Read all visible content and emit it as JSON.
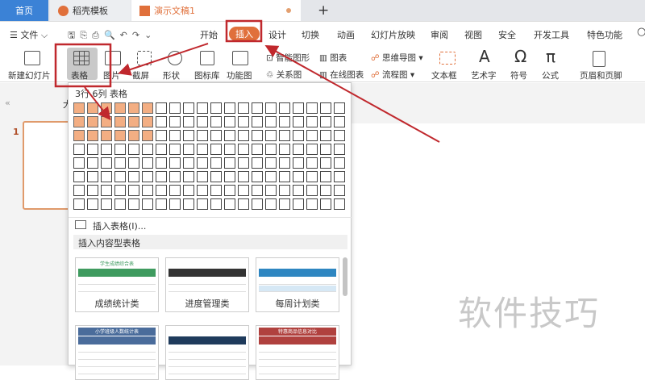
{
  "tabs": [
    {
      "label": "首页"
    },
    {
      "label": "稻壳模板"
    },
    {
      "label": "演示文稿1"
    }
  ],
  "new_tab": "+",
  "menu": {
    "file": "文件",
    "items": [
      "开始",
      "插入",
      "设计",
      "切换",
      "动画",
      "幻灯片放映",
      "审阅",
      "视图",
      "安全",
      "开发工具",
      "特色功能"
    ]
  },
  "ribbon": {
    "new_slide": "新建幻灯片",
    "table": "表格",
    "picture": "图片",
    "screenshot": "截屏",
    "shape": "形状",
    "icon_lib": "图标库",
    "func_chart": "功能图",
    "smart_shape": "智能图形",
    "relation": "关系图",
    "chart": "图表",
    "online_chart": "在线图表",
    "mindmap": "思维导图",
    "flowchart": "流程图",
    "textbox": "文本框",
    "wordart": "艺术字",
    "symbol": "符号",
    "formula": "公式",
    "header_footer": "页眉和页脚"
  },
  "left_panel": {
    "collapse": "«",
    "slide_number": "1",
    "outline": "大"
  },
  "dropdown": {
    "grid_label": "3行 6列 表格",
    "selected_rows": 3,
    "selected_cols": 6,
    "grid_rows": 8,
    "grid_cols": 20,
    "insert_table": "插入表格(I)...",
    "section_title": "插入内容型表格",
    "templates": [
      {
        "label": "成绩统计类",
        "title": "学生成绩综合表",
        "color": "#3f9b5f"
      },
      {
        "label": "进度管理类",
        "title": "",
        "color": "#333333"
      },
      {
        "label": "每周计划类",
        "title": "",
        "color": "#2e86c1"
      },
      {
        "label": "",
        "title": "小学班级人数统计表",
        "color": "#4a6c9b"
      },
      {
        "label": "",
        "title": "",
        "color": "#1f3b5c"
      },
      {
        "label": "",
        "title": "特惠商品信息对比",
        "color": "#b0413e"
      }
    ]
  },
  "watermark": "软件技巧",
  "colors": {
    "accent": "#e0703b",
    "annotation": "#c0282d",
    "home_tab": "#3b82d6"
  }
}
